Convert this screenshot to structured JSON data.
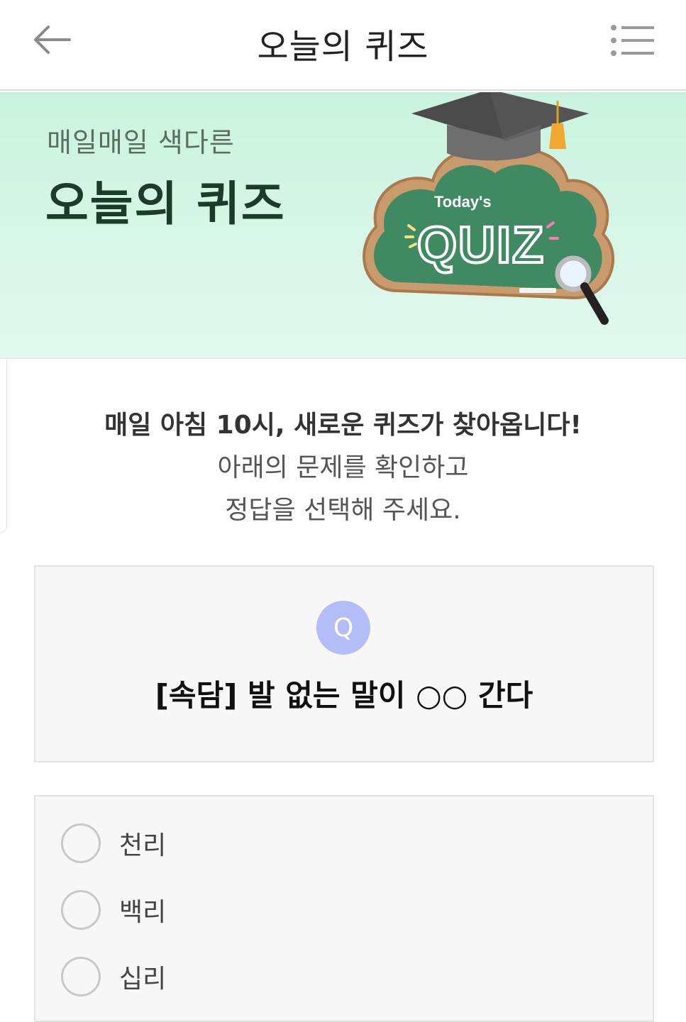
{
  "header": {
    "title": "오늘의 퀴즈",
    "back_icon": "arrow-left-icon",
    "menu_icon": "list-menu-icon"
  },
  "banner": {
    "subtitle": "매일매일 색다른",
    "title": "오늘의 퀴즈",
    "art": {
      "caption": "Today's",
      "word": "QUIZ"
    },
    "colors": {
      "background": "#c9f3df",
      "chalkboard": "#3f8a62",
      "frame": "#c99a6b"
    }
  },
  "intro": {
    "line1": "매일 아침 10시, 새로운 퀴즈가 찾아옵니다!",
    "line2": "아래의 문제를 확인하고",
    "line3": "정답을 선택해 주세요."
  },
  "question": {
    "badge": "Q",
    "text": "[속담] 발 없는 말이 ○○ 간다",
    "badge_color": "#b4bdf7"
  },
  "options": [
    {
      "label": "천리",
      "selected": false
    },
    {
      "label": "백리",
      "selected": false
    },
    {
      "label": "십리",
      "selected": false
    }
  ]
}
